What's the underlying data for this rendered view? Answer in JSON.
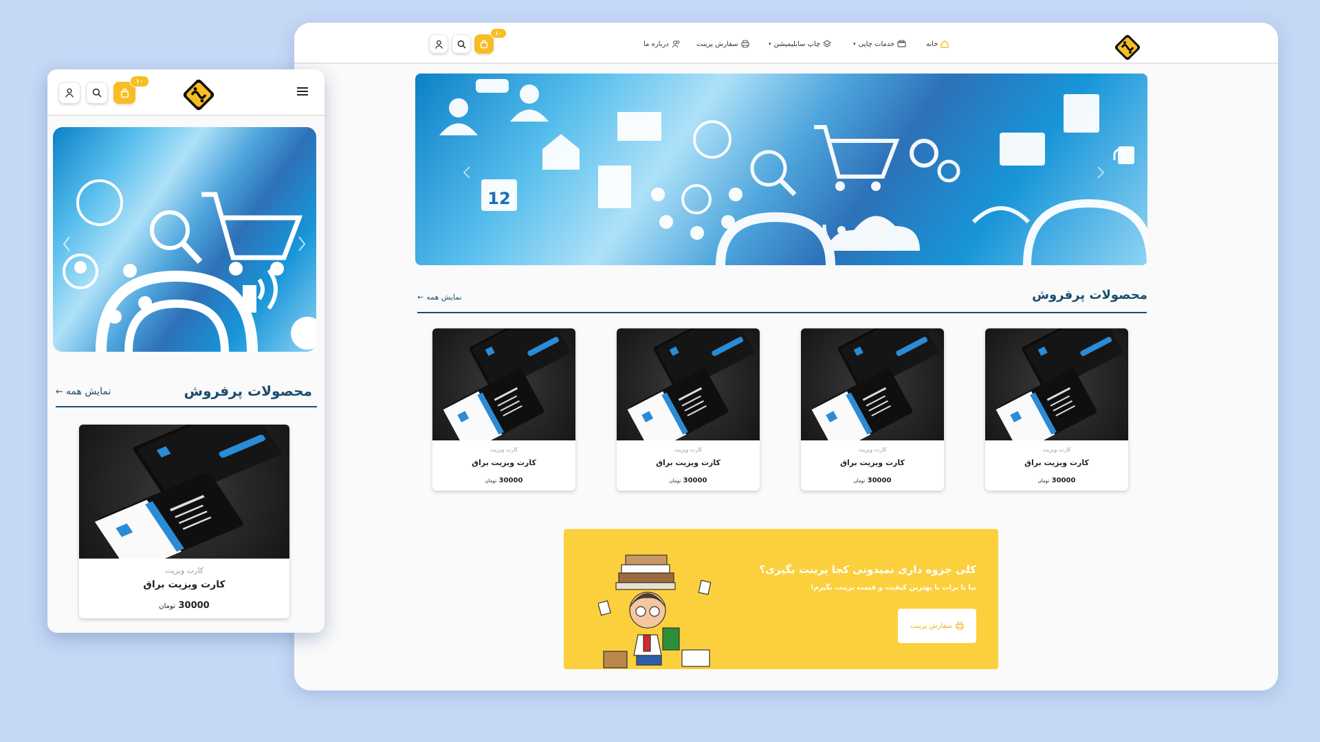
{
  "colors": {
    "accent": "#f7bd23",
    "title": "#1a4d6e",
    "promo_bg": "#fbd03c",
    "background": "#c5d8f5"
  },
  "desktop": {
    "cart_badge": "۱۰",
    "nav": [
      {
        "label": "خانه",
        "icon": "home-icon"
      },
      {
        "label": "خدمات چاپی",
        "icon": "printer-services-icon",
        "dropdown": true
      },
      {
        "label": "چاپ سابلیمیشن",
        "icon": "layers-icon",
        "dropdown": true
      },
      {
        "label": "سفارش پرینت",
        "icon": "printer-icon"
      },
      {
        "label": "درباره ما",
        "icon": "users-icon"
      }
    ],
    "hero": {
      "date_icon_text": "12"
    },
    "bestsellers": {
      "title": "محصولات پرفروش",
      "see_all": "نمایش همه",
      "products": [
        {
          "category": "کارت ویزیت",
          "name": "کارت ویزیت براق",
          "price": "30000",
          "currency": "تومان"
        },
        {
          "category": "کارت ویزیت",
          "name": "کارت ویزیت براق",
          "price": "30000",
          "currency": "تومان"
        },
        {
          "category": "کارت ویزیت",
          "name": "کارت ویزیت براق",
          "price": "30000",
          "currency": "تومان"
        },
        {
          "category": "کارت ویزیت",
          "name": "کارت ویزیت براق",
          "price": "30000",
          "currency": "تومان"
        }
      ]
    },
    "promo": {
      "heading": "کلی جزوه داری نمیدونی کجا پرینت بگیری؟",
      "subtext": "بیا تا برات با بهترین کیفیت و قیمت پرینت بگیرم!",
      "button": "سفارش پرینت"
    }
  },
  "mobile": {
    "cart_badge": "۱۰",
    "bestsellers": {
      "title": "محصولات پرفروش",
      "see_all": "نمایش همه",
      "products": [
        {
          "category": "کارت ویزیت",
          "name": "کارت ویزیت براق",
          "price": "30000",
          "currency": "تومان"
        }
      ]
    }
  }
}
